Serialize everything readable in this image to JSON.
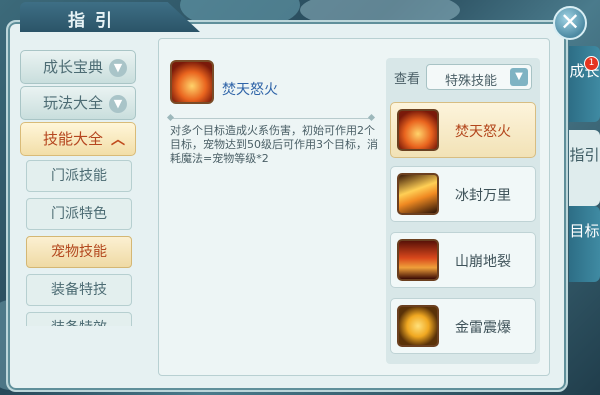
{
  "header": {
    "title": "指引",
    "close_symbol": "✕"
  },
  "categories": [
    {
      "label": "成长宝典",
      "chevron": "▼",
      "active": false
    },
    {
      "label": "玩法大全",
      "chevron": "▼",
      "active": false
    },
    {
      "label": "技能大全",
      "chevron": "︿",
      "active": true
    }
  ],
  "subcategories": [
    {
      "label": "门派技能",
      "active": false
    },
    {
      "label": "门派特色",
      "active": false
    },
    {
      "label": "宠物技能",
      "active": true
    },
    {
      "label": "装备特技",
      "active": false
    },
    {
      "label": "装备特效",
      "active": false
    }
  ],
  "detail": {
    "skill_name": "焚天怒火",
    "description": "对多个目标造成火系伤害，初始可作用2个目标，宠物达到50级后可作用3个目标，消耗魔法=宠物等级*2"
  },
  "filter": {
    "label": "查看",
    "selected": "特殊技能",
    "arrow": "▼"
  },
  "skills": [
    {
      "name": "焚天怒火",
      "icon": "fire-burst-icon",
      "active": true
    },
    {
      "name": "冰封万里",
      "icon": "ice-shards-icon",
      "active": false
    },
    {
      "name": "山崩地裂",
      "icon": "earth-crack-icon",
      "active": false
    },
    {
      "name": "金雷震爆",
      "icon": "thunder-orb-icon",
      "active": false
    }
  ],
  "side_tabs": [
    {
      "label": "成长",
      "badge": "1"
    },
    {
      "label": "指引"
    },
    {
      "label": "目标"
    }
  ]
}
